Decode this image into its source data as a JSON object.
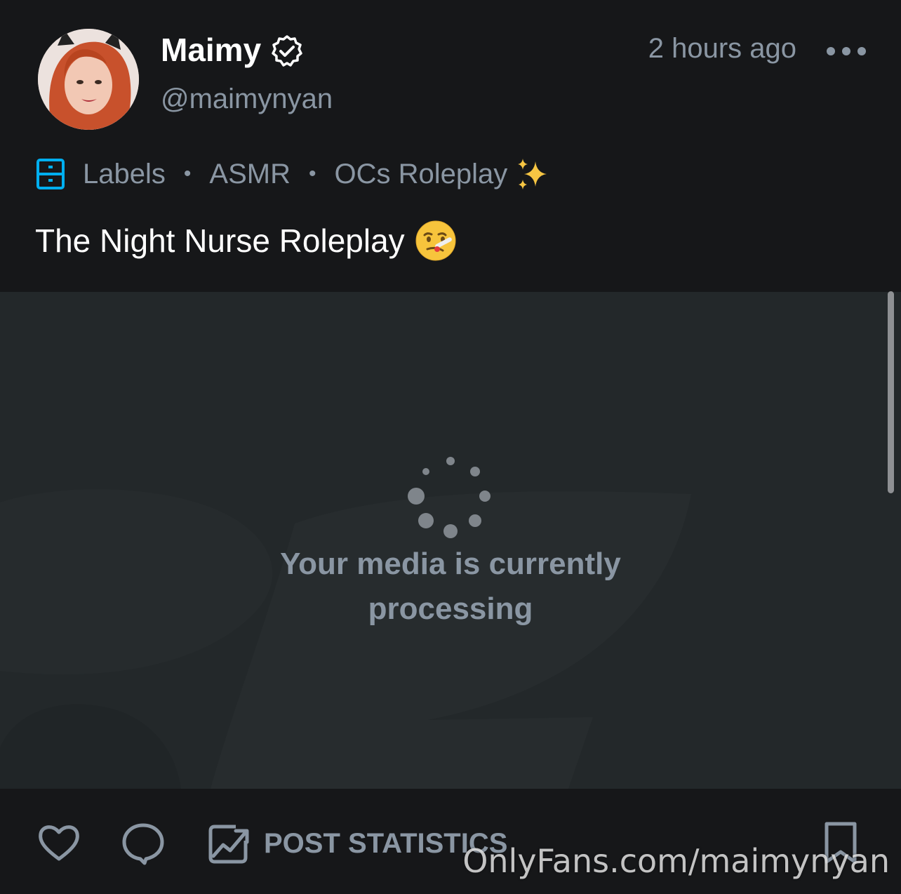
{
  "post": {
    "author": {
      "name": "Maimy",
      "handle": "@maimynyan",
      "verified": true
    },
    "timestamp": "2 hours ago",
    "labels": {
      "heading": "Labels",
      "items": [
        "ASMR",
        "OCs Roleplay"
      ]
    },
    "title": "The Night Nurse Roleplay",
    "media": {
      "status_text": "Your media is currently processing"
    },
    "actions": {
      "statistics_label": "POST STATISTICS"
    }
  },
  "watermark": "OnlyFans.com/maimynyan",
  "icons": {
    "verified": "verified-badge-icon",
    "more": "more-options-icon",
    "labels": "labels-drawer-icon",
    "like": "heart-icon",
    "comment": "comment-bubble-icon",
    "statistics": "chart-image-icon",
    "bookmark": "bookmark-icon",
    "spinner": "loading-spinner-icon"
  },
  "colors": {
    "background": "#161719",
    "media_background": "#23282a",
    "text_primary": "#ffffff",
    "text_secondary": "#8a96a3",
    "accent": "#00aff0"
  }
}
